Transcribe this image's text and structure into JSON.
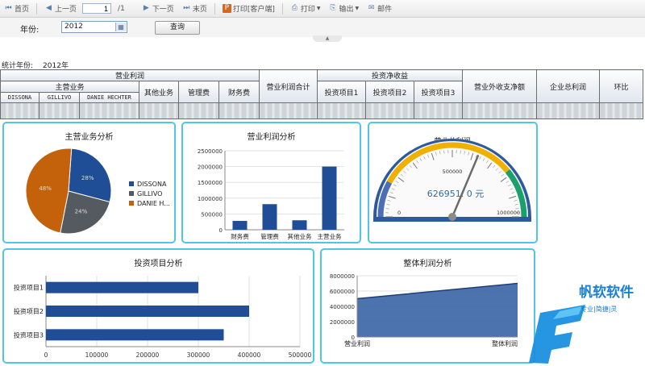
{
  "toolbar": {
    "first": "首页",
    "prev": "上一页",
    "page_value": "1",
    "page_total": "/1",
    "next": "下一页",
    "last": "末页",
    "print_client": "打印[客户端]",
    "print": "打印",
    "export": "输出",
    "mail": "邮件"
  },
  "filter": {
    "year_label": "年份:",
    "year_value": "2012",
    "query_label": "查询"
  },
  "stat": {
    "label": "统计年份:",
    "value": "2012年"
  },
  "table": {
    "operating_profit": "营业利润",
    "main_business": "主营业务",
    "sub_cols": [
      "DISSONA",
      "GILLIVO",
      "DANIE HECHTER"
    ],
    "other_business": "其他业务",
    "mgmt_fee": "管理费",
    "finance_fee": "财务费",
    "op_profit_total": "营业利润合计",
    "invest_income": "投资净收益",
    "invest_items": [
      "投资项目1",
      "投资项目2",
      "投资项目3"
    ],
    "non_op": "营业外收支净额",
    "total_profit": "企业总利润",
    "yoy": "环比"
  },
  "colors": {
    "panel_border": "#4fc6e6",
    "bar": "#1f4e96",
    "pie": [
      "#1f4e96",
      "#555a60",
      "#c4620c"
    ],
    "area": "#3a64a5"
  },
  "chart_data": [
    {
      "type": "pie",
      "title": "主营业务分析",
      "categories": [
        "DISSONA",
        "GILLIVO",
        "DANIE H..."
      ],
      "values": [
        28,
        24,
        48
      ],
      "labels": [
        "28%",
        "24%",
        "48%"
      ],
      "legend": "right"
    },
    {
      "type": "bar",
      "title": "营业利润分析",
      "categories": [
        "财务费",
        "管理费",
        "其他业务",
        "主营业务"
      ],
      "values": [
        280000,
        810000,
        300000,
        2000000
      ],
      "ylim": [
        0,
        2500000
      ],
      "yticks": [
        "0",
        "500000",
        "1000000",
        "1500000",
        "2000000",
        "2500000"
      ],
      "grid": true
    },
    {
      "type": "gauge",
      "title": "营业总利润",
      "value": 626951,
      "value_label": "626951. 0 元",
      "range": [
        0,
        1000000
      ],
      "ticks": [
        "0",
        "500000",
        "1000000"
      ]
    },
    {
      "type": "bar",
      "orientation": "horizontal",
      "title": "投资项目分析",
      "categories": [
        "投资项目1",
        "投资项目2",
        "投资项目3"
      ],
      "values": [
        300000,
        400000,
        350000
      ],
      "xlim": [
        0,
        500000
      ],
      "xticks": [
        "0",
        "100000",
        "200000",
        "300000",
        "400000",
        "500000"
      ],
      "grid": true
    },
    {
      "type": "area",
      "title": "整体利润分析",
      "categories": [
        "营业利润",
        "整体利润"
      ],
      "values": [
        5000000,
        7000000
      ],
      "ylim": [
        0,
        8000000
      ],
      "yticks": [
        "0",
        "2000000",
        "4000000",
        "6000000",
        "8000000"
      ],
      "grid": true
    }
  ],
  "watermark": {
    "brand": "帆软软件",
    "tagline": "专业|简捷|灵"
  }
}
